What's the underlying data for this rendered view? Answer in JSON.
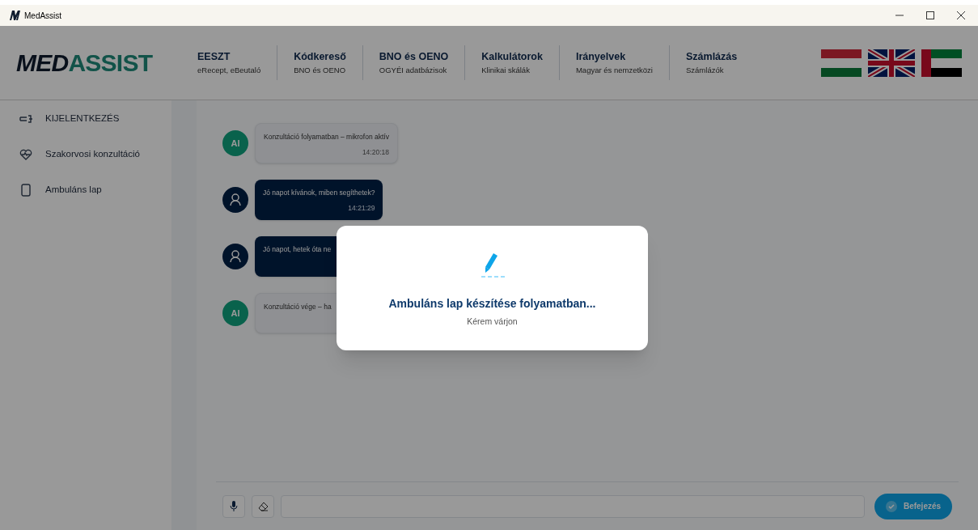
{
  "window": {
    "title": "MedAssist"
  },
  "header": {
    "logo": {
      "dark": "MED",
      "accent": "ASSIST"
    },
    "nav": [
      {
        "title": "EESZT",
        "subtitle": "eRecept, eBeutaló"
      },
      {
        "title": "Kódkereső",
        "subtitle": "BNO és OENO"
      },
      {
        "title": "BNO és OENO",
        "subtitle": "OGYÉI adatbázisok"
      },
      {
        "title": "Kalkulátorok",
        "subtitle": "Klinikai skálák"
      },
      {
        "title": "Irányelvek",
        "subtitle": "Magyar és nemzetközi"
      },
      {
        "title": "Számlázás",
        "subtitle": "Számlázók"
      }
    ],
    "flags": [
      {
        "kind": "hu"
      },
      {
        "kind": "uk"
      },
      {
        "kind": "ae"
      }
    ]
  },
  "sidebar": {
    "items": [
      {
        "kind": "logout",
        "label": "KIJELENTKEZÉS"
      },
      {
        "kind": "heart",
        "label": "Szakorvosi konzultáció"
      },
      {
        "kind": "page",
        "label": "Ambuláns lap"
      }
    ]
  },
  "chat": {
    "messages": [
      {
        "kind": "ai",
        "avatar": "AI",
        "text": "Konzultáció folyamatban – mikrofon aktív",
        "time": "14:20:18"
      },
      {
        "kind": "user",
        "text": "Jó napot kívánok, miben segíthetek?",
        "time": "14:21:29"
      },
      {
        "kind": "user",
        "text": "Jó napot, hetek óta ne"
      },
      {
        "kind": "ai",
        "avatar": "AI",
        "text": "Konzultáció vége – ha"
      }
    ],
    "finish_button": "Befejezés"
  },
  "dialog": {
    "title": "Ambuláns lap készítése folyamatban...",
    "subtitle": "Kérem várjon"
  }
}
